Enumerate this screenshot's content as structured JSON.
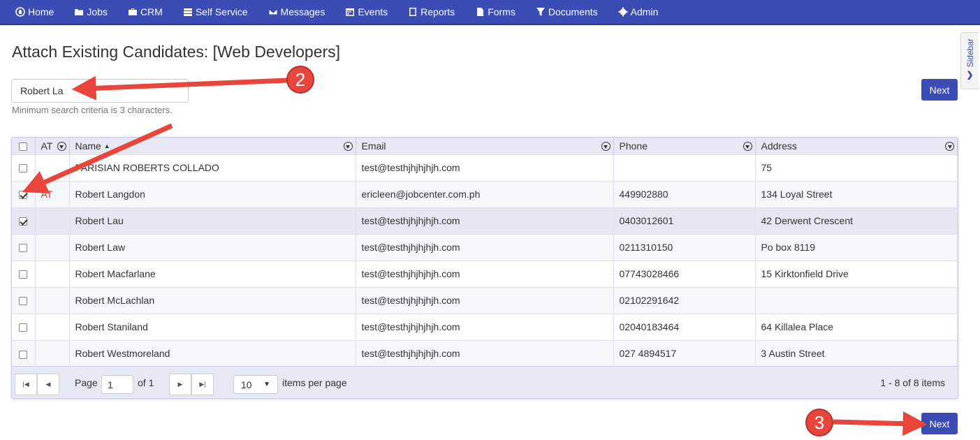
{
  "nav": {
    "items": [
      {
        "label": "Home",
        "icon": "home-icon"
      },
      {
        "label": "Jobs",
        "icon": "folder-icon"
      },
      {
        "label": "CRM",
        "icon": "briefcase-icon"
      },
      {
        "label": "Self Service",
        "icon": "server-icon"
      },
      {
        "label": "Messages",
        "icon": "envelope-icon"
      },
      {
        "label": "Events",
        "icon": "calendar-icon"
      },
      {
        "label": "Reports",
        "icon": "book-icon"
      },
      {
        "label": "Forms",
        "icon": "file-icon"
      },
      {
        "label": "Documents",
        "icon": "filter-icon"
      },
      {
        "label": "Admin",
        "icon": "gear-icon"
      }
    ]
  },
  "page": {
    "title": "Attach Existing Candidates: [Web Developers]",
    "search_value": "Robert La",
    "hint": "Minimum search criteria is 3 characters.",
    "next_label": "Next",
    "sidebar_label": "Sidebar"
  },
  "grid": {
    "columns": [
      "AT",
      "Name",
      "Email",
      "Phone",
      "Address"
    ],
    "sort_indicator": "▲",
    "rows": [
      {
        "checked": false,
        "at": "",
        "name": "PARISIAN ROBERTS COLLADO",
        "email": "test@testhjhjhjhjh.com",
        "phone": "",
        "address": "75"
      },
      {
        "checked": true,
        "at": "AT",
        "name": "Robert Langdon",
        "email": "ericleen@jobcenter.com.ph",
        "phone": "449902880",
        "address": "134 Loyal Street"
      },
      {
        "checked": true,
        "at": "",
        "name": "Robert Lau",
        "email": "test@testhjhjhjhjh.com",
        "phone": "0403012601",
        "address": "42 Derwent Crescent"
      },
      {
        "checked": false,
        "at": "",
        "name": "Robert Law",
        "email": "test@testhjhjhjhjh.com",
        "phone": "0211310150",
        "address": "Po box 8119"
      },
      {
        "checked": false,
        "at": "",
        "name": "Robert Macfarlane",
        "email": "test@testhjhjhjhjh.com",
        "phone": "07743028466",
        "address": "15 Kirktonfield Drive"
      },
      {
        "checked": false,
        "at": "",
        "name": "Robert McLachlan",
        "email": "test@testhjhjhjhjh.com",
        "phone": "02102291642",
        "address": ""
      },
      {
        "checked": false,
        "at": "",
        "name": "Robert Staniland",
        "email": "test@testhjhjhjhjh.com",
        "phone": "02040183464",
        "address": "64 Killalea Place"
      },
      {
        "checked": false,
        "at": "",
        "name": "Robert Westmoreland",
        "email": "test@testhjhjhjhjh.com",
        "phone": "027 4894517",
        "address": "3 Austin Street"
      }
    ]
  },
  "pager": {
    "page_label": "Page",
    "page_value": "1",
    "of_label": "of 1",
    "per_page_value": "10",
    "per_page_label": "items per page",
    "summary": "1 - 8 of 8 items"
  },
  "annotations": [
    "2",
    "3"
  ],
  "colors": {
    "accent": "#3b4cb5",
    "marker": "#e8453c",
    "at_flag": "#d9302c"
  }
}
